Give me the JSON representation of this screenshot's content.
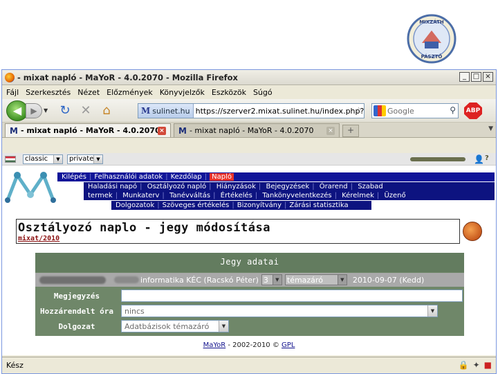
{
  "slide_logo": {
    "top_text": "MIXZÁTH",
    "bottom_text": "PÁSZTÓ"
  },
  "window": {
    "title": "- mixat napló - MaYoR - 4.0.2070 - Mozilla Firefox",
    "controls": [
      "_",
      "□",
      "×"
    ]
  },
  "menu": [
    "Fájl",
    "Szerkesztés",
    "Nézet",
    "Előzmények",
    "Könyvjelzők",
    "Eszközök",
    "Súgó"
  ],
  "address": {
    "site": "sulinet.hu",
    "url": "https://szerver2.mixat.sulinet.hu/index.php?",
    "search_placeholder": "Google",
    "abp_label": "ABP"
  },
  "tabs": [
    {
      "label": "- mixat napló - MaYoR - 4.0.2070",
      "active": true
    },
    {
      "label": "- mixat napló - MaYoR - 4.0.2070",
      "active": false
    }
  ],
  "controls_row": {
    "skin_select": "classic",
    "policy_select": "private",
    "help": "?"
  },
  "nav": {
    "level1": [
      "Kilépés",
      "Felhasználói adatok",
      "Kezdőlap",
      "Napló"
    ],
    "level1_highlight": "Napló",
    "level2_line1": [
      "Haladási napó",
      "Osztályozó napló",
      "Hiányzások",
      "Bejegyzések",
      "Órarend",
      "Szabad"
    ],
    "level2_line2": [
      "termek",
      "Munkaterv",
      "Tanévváltás",
      "Értékelés",
      "Tankönyvelentkezés",
      "Kérelmek",
      "Üzenő"
    ],
    "level3": [
      "Dolgozatok",
      "Szöveges értékelés",
      "Bizonyítvány",
      "Zárási statisztika"
    ]
  },
  "heading": {
    "title": "Osztályozó naplo - jegy módosítása",
    "subtitle": "mixat/2010"
  },
  "grade_form": {
    "header": "Jegy adatai",
    "subject": "informatika KÉC (Racskó Péter)",
    "grade": "3",
    "type": "témazáró",
    "date": "2010-09-07 (Kedd)",
    "note_label": "Megjegyzés",
    "note_value": "",
    "lesson_label": "Hozzárendelt óra",
    "lesson_value": "nincs",
    "test_label": "Dolgozat",
    "test_value": "Adatbázisok témazáró"
  },
  "footer": {
    "brand": "MaYoR",
    "years": "- 2002-2010 ©",
    "license": "GPL"
  },
  "status": {
    "text": "Kész"
  }
}
